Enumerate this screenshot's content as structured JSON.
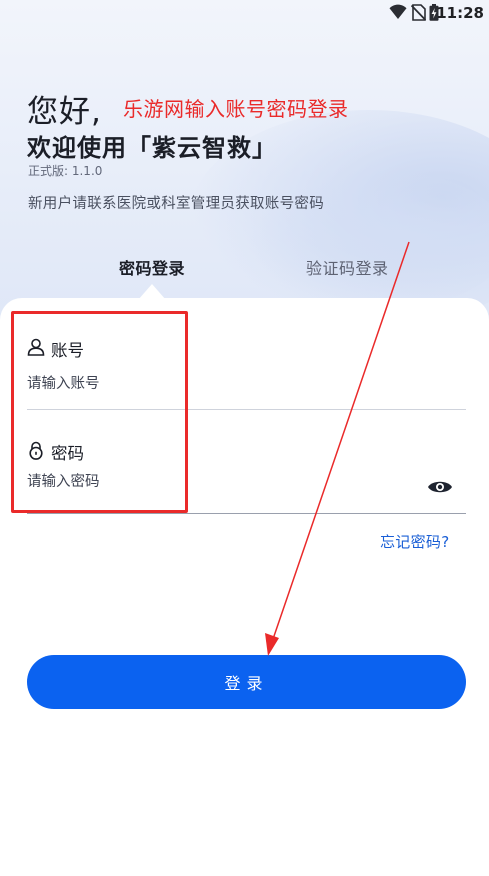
{
  "status_bar": {
    "time": "11:28",
    "icons": [
      "wifi-icon",
      "no-sim-icon",
      "battery-charging-icon"
    ]
  },
  "header": {
    "greeting": "您好,",
    "annotation": "乐游网输入账号密码登录",
    "welcome": "欢迎使用「紫云智救」",
    "version": "正式版: 1.1.0",
    "hint": "新用户请联系医院或科室管理员获取账号密码"
  },
  "tabs": [
    {
      "label": "密码登录",
      "active": true
    },
    {
      "label": "验证码登录",
      "active": false
    }
  ],
  "form": {
    "account": {
      "label": "账号",
      "icon": "user-icon",
      "value": "",
      "placeholder": "请输入账号"
    },
    "password": {
      "label": "密码",
      "icon": "lock-icon",
      "value": "",
      "placeholder": "请输入密码",
      "toggle_icon": "eye-icon"
    },
    "forgot_label": "忘记密码?",
    "submit_label": "登录"
  },
  "colors": {
    "accent": "#0b62f0",
    "link": "#1a5fd6",
    "annotation": "#ea2a2a"
  }
}
